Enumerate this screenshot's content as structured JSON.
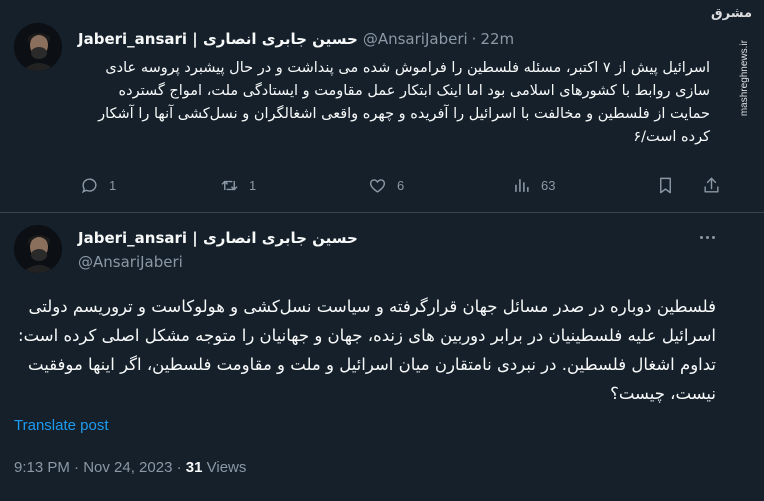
{
  "reply_tweet": {
    "display_name": "Jaberi_ansari | حسین جابری انصاری",
    "handle": "@AnsariJaberi",
    "separator": "·",
    "time": "22m",
    "text": "اسرائیل پیش از ۷ اکتبر، مسئله فلسطین را فراموش شده می پنداشت و در حال پیشبرد پروسه عادی سازی روابط با کشورهای اسلامی بود اما اینک ابتکار عمل مقاومت و ایستادگی ملت، امواج گسترده حمایت از فلسطین و مخالفت با اسرائیل را آفریده و چهره واقعی اشغالگران و نسل‌کشی آنها را آشکار کرده است/۶",
    "replies": "1",
    "reposts": "1",
    "likes": "6",
    "views": "63"
  },
  "main_tweet": {
    "display_name": "Jaberi_ansari | حسین جابری انصاری",
    "handle": "@AnsariJaberi",
    "text": "فلسطین دوباره در صدر مسائل جهان قرارگرفته و سیاست نسل‌کشی و هولوکاست و تروریسم دولتی اسرائیل علیه فلسطینیان در برابر دوربین های زنده، جهان و جهانیان را متوجه مشکل اصلی کرده است: تداوم اشغال فلسطین. در نبردی نامتقارن میان اسرائیل و ملت و مقاومت فلسطین، اگر اینها موفقیت نیست، چیست؟",
    "translate_label": "Translate post",
    "timestamp": "9:13 PM · Nov 24, 2023",
    "meta_sep": " · ",
    "views_count": "31",
    "views_label": " Views"
  },
  "watermark": {
    "logo": "مشرق",
    "site": "mashreghnews.ir"
  },
  "icons": {
    "reply": "reply-icon",
    "repost": "repost-icon",
    "like": "like-icon",
    "views": "views-icon",
    "bookmark": "bookmark-icon",
    "share": "share-icon",
    "more": "more-icon"
  },
  "colors": {
    "background": "#15202b",
    "text": "#f7f9f9",
    "secondary": "#8b98a5",
    "link": "#1d9bf0",
    "divider": "#38444d"
  }
}
